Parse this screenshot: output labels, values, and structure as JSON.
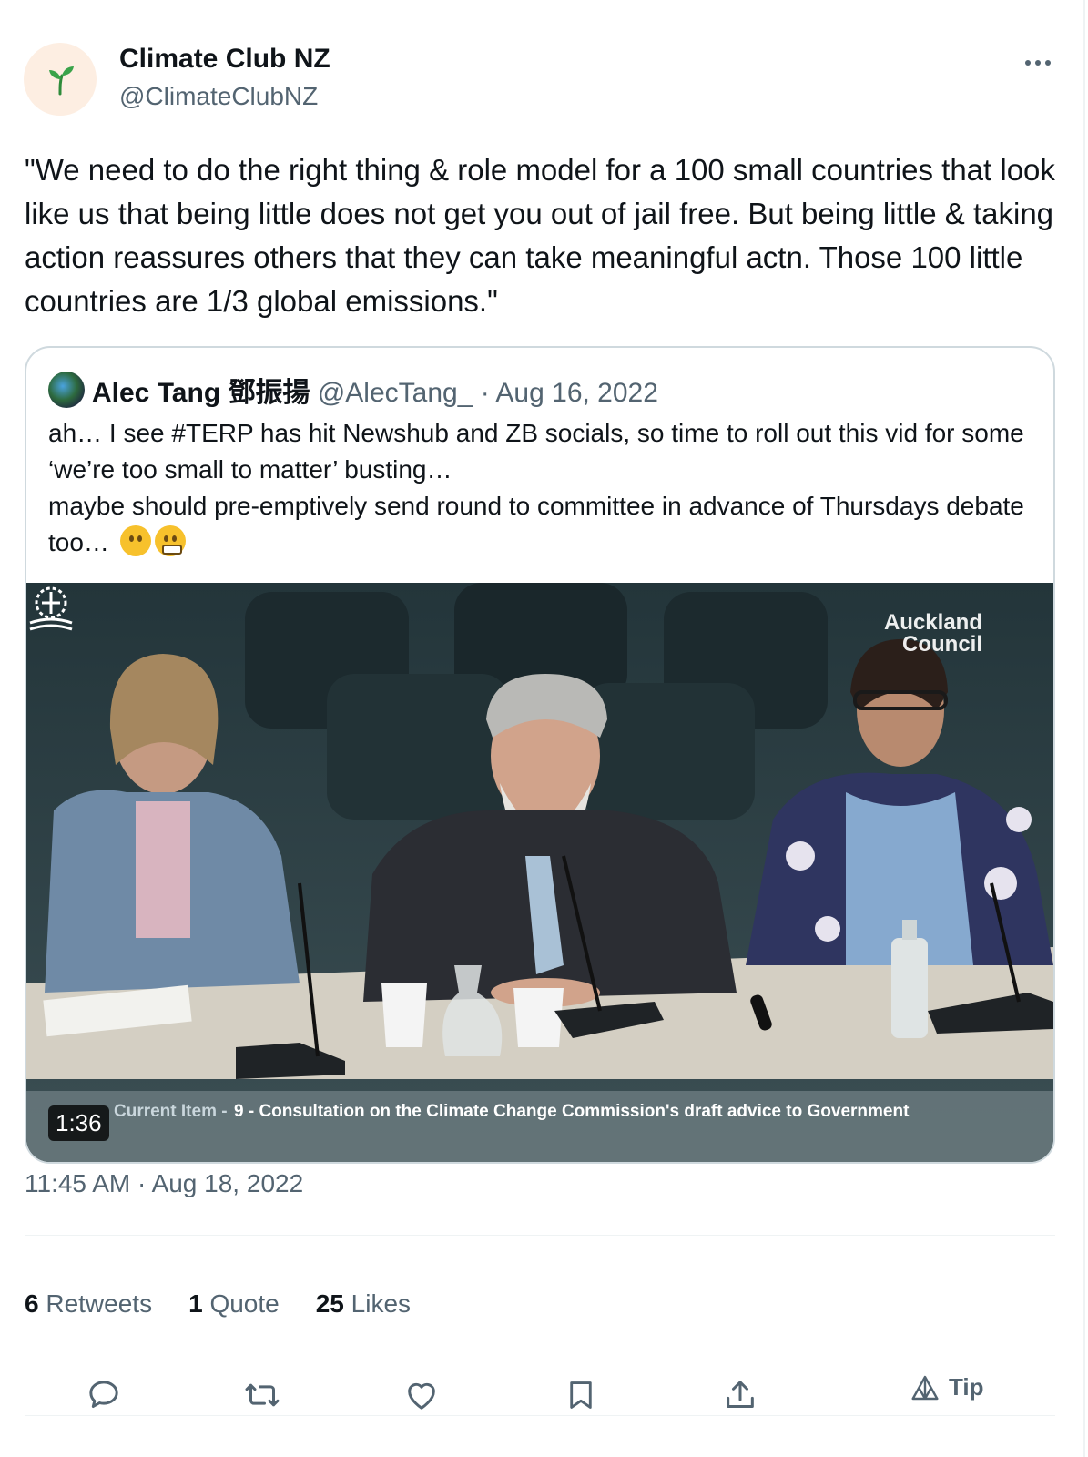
{
  "author": {
    "name": "Climate Club NZ",
    "handle": "@ClimateClubNZ",
    "avatar_icon": "seedling-icon"
  },
  "tweet": {
    "text": "\"We need to do the right thing & role model for a 100 small countries that look like us that being little does not get you out of jail free. But being little & taking action reassures others that they can take meaningful actn. Those 100 little countries are 1/3 global emissions.\""
  },
  "quoted": {
    "name": "Alec Tang 鄧振揚",
    "handle": "@AlecTang_",
    "separator": "·",
    "date": "Aug 16, 2022",
    "line1": "ah… I see #TERP has hit Newshub and  ZB socials, so time to roll out this vid for some ‘we’re too small to matter’ busting…",
    "line2": "maybe should pre-emptively send round to committee in advance of Thursdays debate too…",
    "emojis": [
      "thinking-face-icon",
      "grimacing-face-icon"
    ]
  },
  "video": {
    "brand_line1": "Auckland",
    "brand_line2": "Council",
    "caption_label": "Current Item -",
    "caption_text": "9 - Consultation on the Climate Change Commission's draft advice to Government",
    "duration": "1:36"
  },
  "timestamp": "11:45 AM · Aug 18, 2022",
  "stats": {
    "retweets_count": "6",
    "retweets_label": "Retweets",
    "quotes_count": "1",
    "quotes_label": "Quote",
    "likes_count": "25",
    "likes_label": "Likes"
  },
  "actions": {
    "tip_label": "Tip"
  },
  "colors": {
    "text_primary": "#0f1419",
    "text_secondary": "#536471",
    "border": "#cfd9de",
    "avatar_bg": "#fdeee2"
  }
}
